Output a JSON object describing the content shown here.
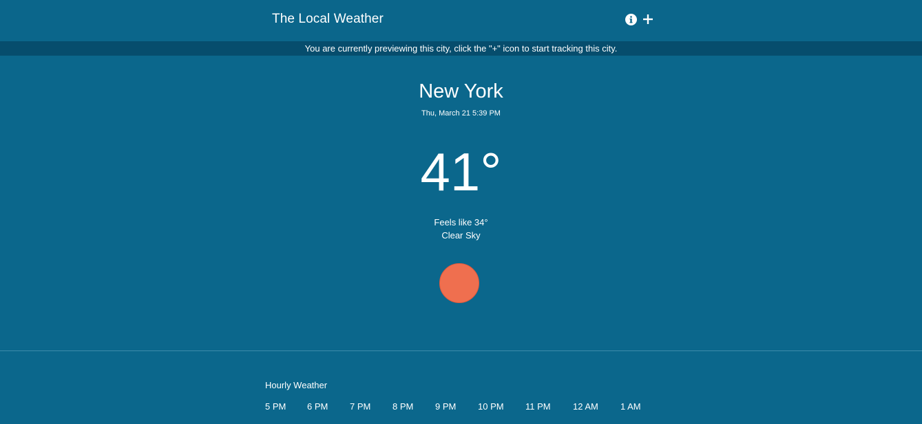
{
  "header": {
    "title": "The Local Weather",
    "info_icon": "info-circle-icon",
    "add_icon": "plus-icon"
  },
  "banner": {
    "text": "You are currently previewing this city, click the \"+\" icon to start tracking this city."
  },
  "current": {
    "city": "New York",
    "datetime": "Thu, March 21 5:39 PM",
    "temperature": "41°",
    "feels_like": "Feels like 34°",
    "condition": "Clear Sky",
    "condition_icon": "sun-icon"
  },
  "hourly": {
    "title": "Hourly Weather",
    "hours": [
      "5 PM",
      "6 PM",
      "7 PM",
      "8 PM",
      "9 PM",
      "10 PM",
      "11 PM",
      "12 AM",
      "1 AM"
    ]
  },
  "colors": {
    "background": "#0b678c",
    "header": "#0b668b",
    "banner": "#064d6d",
    "sun": "#ef6f4f",
    "text": "#ffffff"
  }
}
